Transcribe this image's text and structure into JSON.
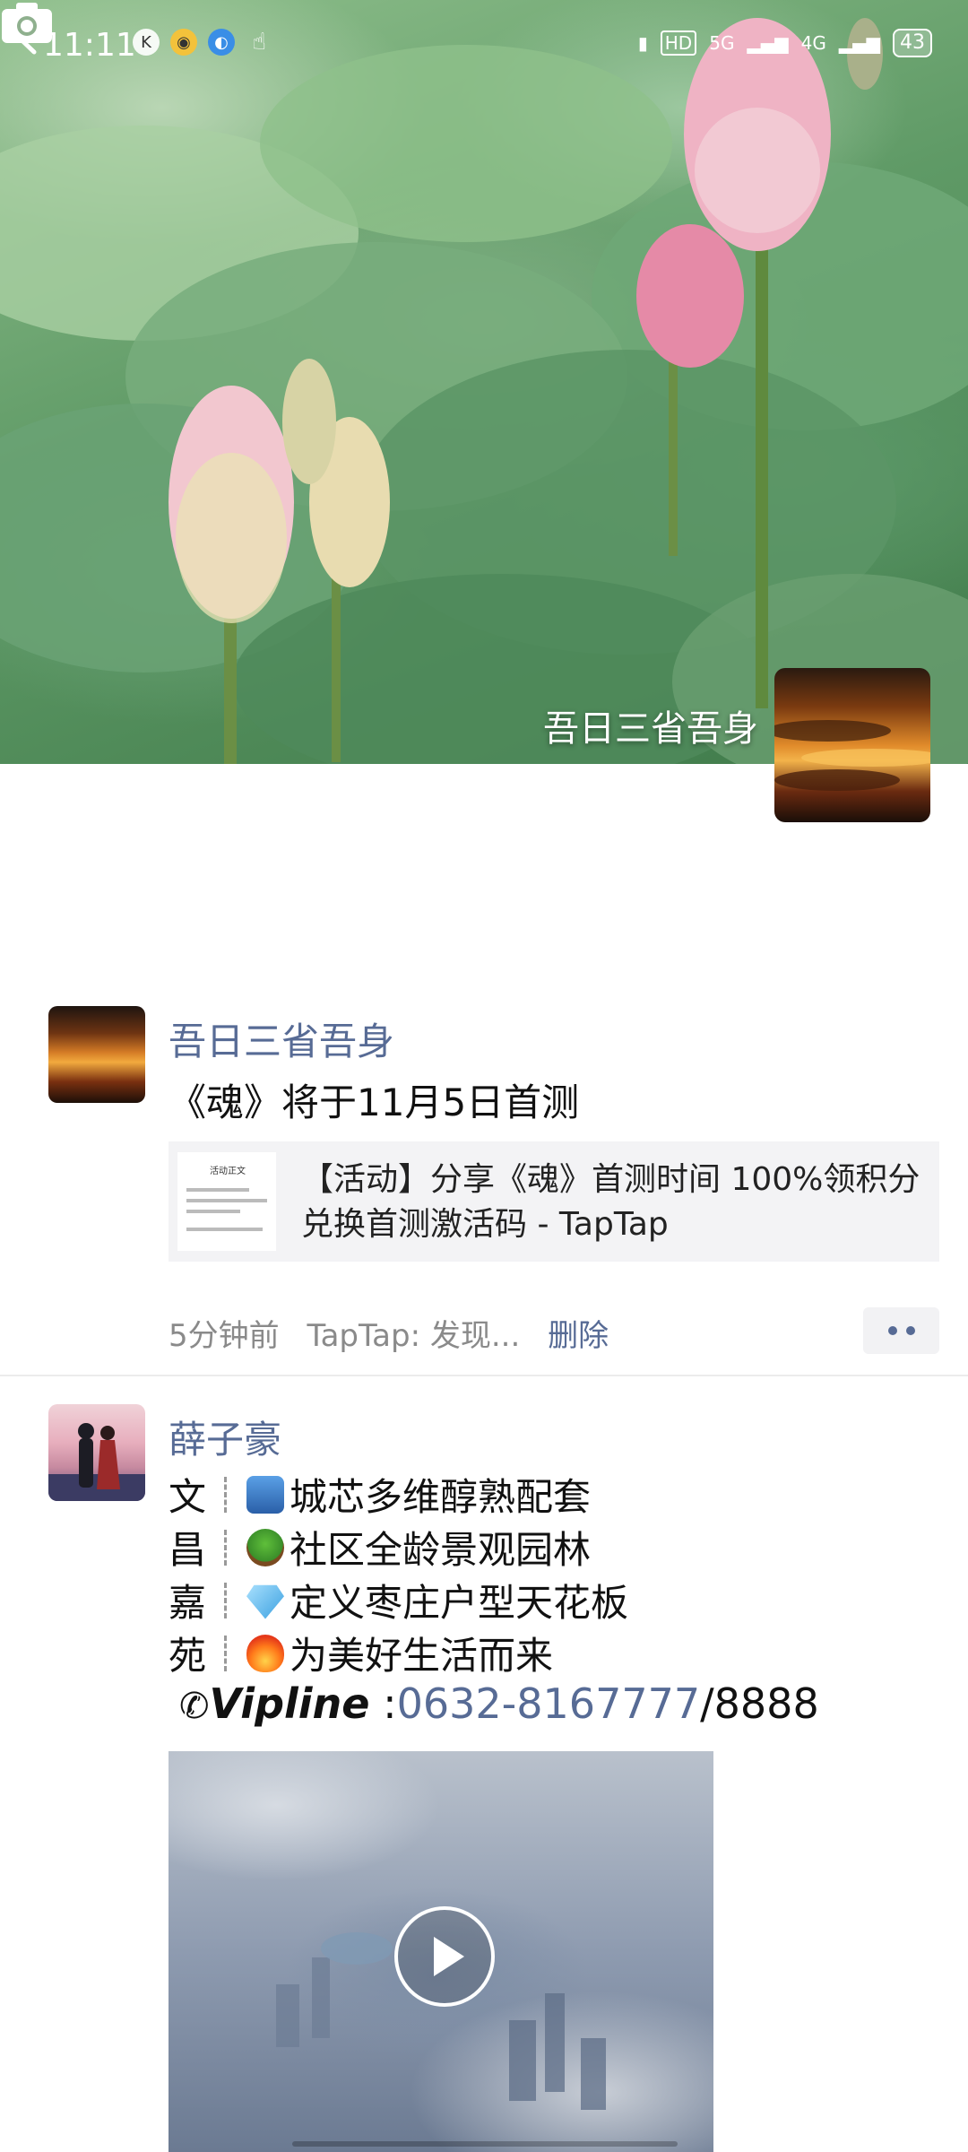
{
  "status_bar": {
    "time": "11:11",
    "left_icons": [
      "k-icon",
      "weibo-icon",
      "browser-icon",
      "hand-icon"
    ],
    "right": {
      "hd": "HD",
      "net1": "5G",
      "net2": "4G",
      "battery": "43"
    }
  },
  "cover": {
    "name": "吾日三省吾身"
  },
  "post1": {
    "name": "吾日三省吾身",
    "text": "《魂》将于11月5日首测",
    "link": {
      "title": "【活动】分享《魂》首测时间 100%领积分兑换首测激活码 - TapTap",
      "thumb_title": "活动正文"
    },
    "time": "5分钟前",
    "source": "TapTap: 发现...",
    "delete": "删除"
  },
  "post2": {
    "name": "薛子豪",
    "rows": [
      {
        "ch": "文",
        "emoji": "city-icon",
        "text": "城芯多维醇熟配套"
      },
      {
        "ch": "昌",
        "emoji": "tree-icon",
        "text": "社区全龄景观园林"
      },
      {
        "ch": "嘉",
        "emoji": "diamond-icon",
        "text": "定义枣庄户型天花板"
      },
      {
        "ch": "苑",
        "emoji": "fire-icon",
        "text": "为美好生活而来"
      }
    ],
    "vip_label": "Vipline",
    "vip_sep": ":",
    "vip_number": "0632-8167777",
    "vip_suffix": "/8888"
  },
  "colors": {
    "link_blue": "#576b95",
    "meta_gray": "#8a8a8a"
  }
}
